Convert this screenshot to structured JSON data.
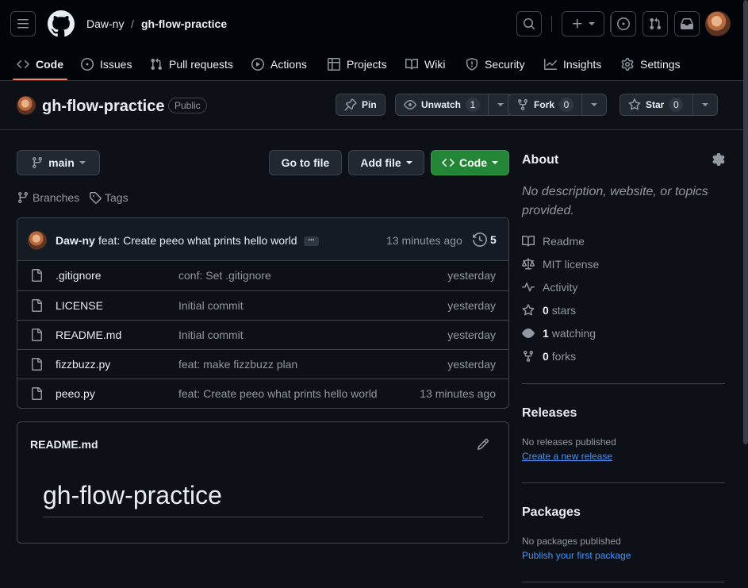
{
  "header": {
    "owner": "Daw-ny",
    "separator": "/",
    "repo": "gh-flow-practice"
  },
  "tabs": [
    {
      "label": "Code",
      "icon": "code-icon"
    },
    {
      "label": "Issues",
      "icon": "issue-icon"
    },
    {
      "label": "Pull requests",
      "icon": "pull-request-icon"
    },
    {
      "label": "Actions",
      "icon": "play-icon"
    },
    {
      "label": "Projects",
      "icon": "table-icon"
    },
    {
      "label": "Wiki",
      "icon": "book-icon"
    },
    {
      "label": "Security",
      "icon": "shield-icon"
    },
    {
      "label": "Insights",
      "icon": "graph-icon"
    },
    {
      "label": "Settings",
      "icon": "gear-icon"
    }
  ],
  "repo": {
    "name": "gh-flow-practice",
    "visibility": "Public",
    "pin_label": "Pin",
    "unwatch_label": "Unwatch",
    "watch_count": "1",
    "fork_label": "Fork",
    "fork_count": "0",
    "star_label": "Star",
    "star_count": "0"
  },
  "toolbar": {
    "branch": "main",
    "go_to_file": "Go to file",
    "add_file": "Add file",
    "code": "Code",
    "branches": "Branches",
    "tags": "Tags"
  },
  "commit": {
    "author": "Daw-ny",
    "message": "feat: Create peeo what prints hello world",
    "ellipsis": "...",
    "time": "13 minutes ago",
    "count": "5"
  },
  "files": [
    {
      "name": ".gitignore",
      "message": "conf: Set .gitignore",
      "time": "yesterday"
    },
    {
      "name": "LICENSE",
      "message": "Initial commit",
      "time": "yesterday"
    },
    {
      "name": "README.md",
      "message": "Initial commit",
      "time": "yesterday"
    },
    {
      "name": "fizzbuzz.py",
      "message": "feat: make fizzbuzz plan",
      "time": "yesterday"
    },
    {
      "name": "peeo.py",
      "message": "feat: Create peeo what prints hello world",
      "time": "13 minutes ago"
    }
  ],
  "readme": {
    "filename": "README.md",
    "heading": "gh-flow-practice"
  },
  "about": {
    "title": "About",
    "description": "No description, website, or topics provided.",
    "readme": "Readme",
    "license": "MIT license",
    "activity": "Activity",
    "stars_count": "0",
    "stars_label": "stars",
    "watching_count": "1",
    "watching_label": "watching",
    "forks_count": "0",
    "forks_label": "forks"
  },
  "releases": {
    "title": "Releases",
    "empty": "No releases published",
    "link": "Create a new release"
  },
  "packages": {
    "title": "Packages",
    "empty": "No packages published",
    "link": "Publish your first package"
  },
  "colors": {
    "background": "#0d1117",
    "header": "#010409",
    "border": "#3d444d",
    "accent_green": "#238636",
    "link": "#4493f8",
    "tab_underline": "#f78166"
  }
}
